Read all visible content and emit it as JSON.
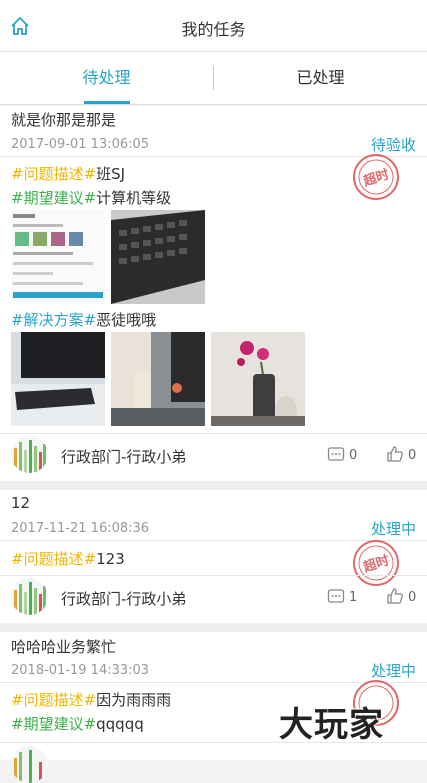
{
  "header": {
    "title": "我的任务"
  },
  "tabs": [
    {
      "label": "待处理"
    },
    {
      "label": "已处理"
    }
  ],
  "stamp_text": "超时",
  "watermark": "大玩家",
  "tasks": [
    {
      "title": "就是你那是那是",
      "date": "2017-09-01 13:06:05",
      "status": "待验收",
      "problem_tag": "#问题描述#",
      "problem_text": "班SJ",
      "suggestion_tag": "#期望建议#",
      "suggestion_text": "计算机等级",
      "solution_tag": "#解决方案#",
      "solution_text": "恶徒哦哦",
      "author": "行政部门-行政小弟",
      "comments": "0",
      "likes": "0"
    },
    {
      "title": "12",
      "date": "2017-11-21 16:08:36",
      "status": "处理中",
      "problem_tag": "#问题描述#",
      "problem_text": "123",
      "author": "行政部门-行政小弟",
      "comments": "1",
      "likes": "0"
    },
    {
      "title": "哈哈哈业务繁忙",
      "date": "2018-01-19 14:33:03",
      "status": "处理中",
      "problem_tag": "#问题描述#",
      "problem_text": "因为雨雨雨",
      "suggestion_tag": "#期望建议#",
      "suggestion_text": "qqqqq"
    }
  ]
}
